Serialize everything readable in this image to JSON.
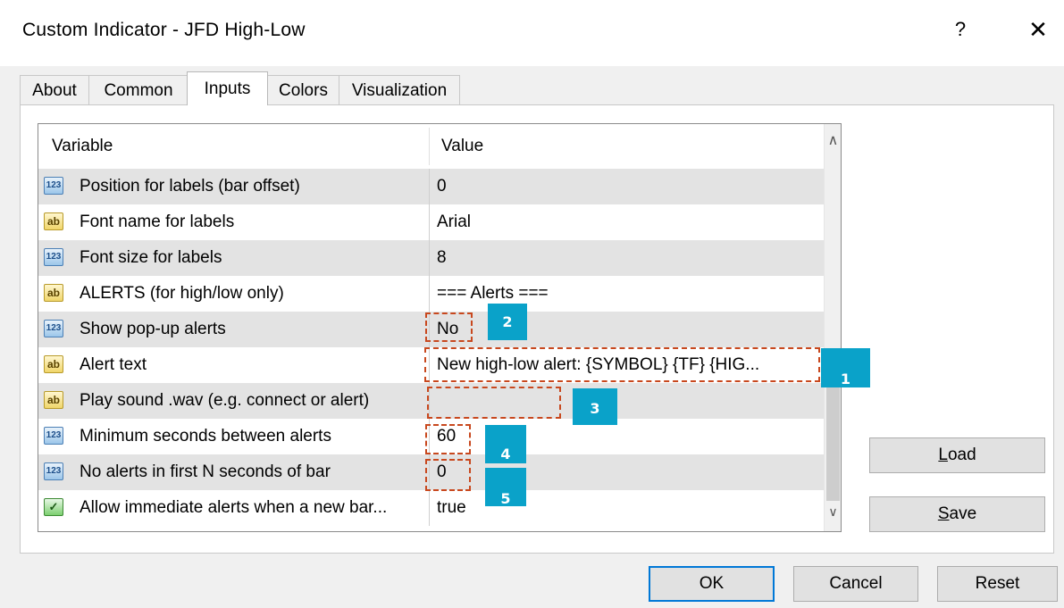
{
  "window": {
    "title": "Custom Indicator - JFD High-Low",
    "help_label": "?",
    "close_label": "✕"
  },
  "tabs": [
    {
      "label": "About",
      "active": false
    },
    {
      "label": "Common",
      "active": false
    },
    {
      "label": "Inputs",
      "active": true
    },
    {
      "label": "Colors",
      "active": false
    },
    {
      "label": "Visualization",
      "active": false
    }
  ],
  "grid": {
    "columns": {
      "variable": "Variable",
      "value": "Value"
    },
    "rows": [
      {
        "type": "number",
        "icon": "123",
        "name": "Position for labels (bar offset)",
        "value": "0"
      },
      {
        "type": "string",
        "icon": "ab",
        "name": "Font name for labels",
        "value": "Arial"
      },
      {
        "type": "number",
        "icon": "123",
        "name": "Font size for labels",
        "value": "8"
      },
      {
        "type": "string",
        "icon": "ab",
        "name": "ALERTS (for high/low only)",
        "value": "=== Alerts ==="
      },
      {
        "type": "number",
        "icon": "123",
        "name": "Show pop-up alerts",
        "value": "No"
      },
      {
        "type": "string",
        "icon": "ab",
        "name": "Alert text",
        "value": "New high-low alert: {SYMBOL} {TF} {HIG..."
      },
      {
        "type": "string",
        "icon": "ab",
        "name": "Play sound .wav (e.g. connect or alert)",
        "value": ""
      },
      {
        "type": "number",
        "icon": "123",
        "name": "Minimum seconds between alerts",
        "value": "60"
      },
      {
        "type": "number",
        "icon": "123",
        "name": "No alerts in first N seconds of bar",
        "value": "0"
      },
      {
        "type": "bool",
        "icon": "✓",
        "name": "Allow immediate alerts when a new bar...",
        "value": "true"
      }
    ],
    "scroll_up": "∧",
    "scroll_down": "∨"
  },
  "callouts": {
    "one": "1",
    "two": "2",
    "three": "3",
    "four": "4",
    "five": "5"
  },
  "colors": {
    "callout_border": "#c8481e",
    "badge": "#0aa2c9",
    "default_button_border": "#0078d7"
  },
  "side_buttons": {
    "load": {
      "mnemonic": "L",
      "rest": "oad"
    },
    "save": {
      "mnemonic": "S",
      "rest": "ave"
    }
  },
  "footer_buttons": {
    "ok": "OK",
    "cancel": "Cancel",
    "reset": "Reset"
  }
}
